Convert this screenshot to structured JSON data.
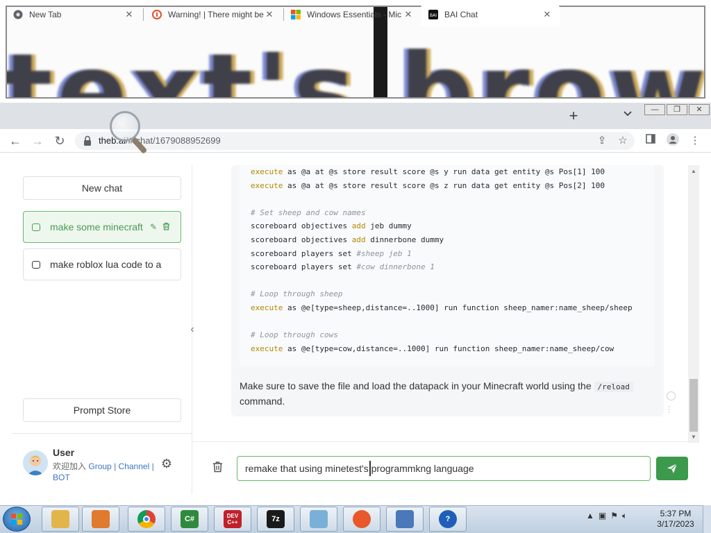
{
  "magnifier": {
    "text": "text's brows"
  },
  "browser": {
    "tabs": [
      {
        "title": "New Tab",
        "icon": "chrome-icon"
      },
      {
        "title": "Warning! | There might be",
        "icon": "warning-site-icon"
      },
      {
        "title": "Windows Essentials - Mic",
        "icon": "microsoft-icon"
      },
      {
        "title": "BAI Chat",
        "icon": "bai-icon",
        "active": true
      }
    ],
    "url_host": "theb.ai",
    "url_path": "/#/chat/1679088952699"
  },
  "sidebar": {
    "new_chat_label": "New chat",
    "chats": [
      {
        "title": "make some minecraft",
        "active": true
      },
      {
        "title": "make roblox lua code to a",
        "active": false
      }
    ],
    "prompt_store_label": "Prompt Store",
    "user": {
      "name": "User",
      "join_text": "欢迎加入",
      "group_link": "Group",
      "sep1": "|",
      "channel_link": "Channel",
      "sep2": "|",
      "bot_link": "BOT"
    }
  },
  "message": {
    "code_lines": [
      [
        {
          "t": "execute",
          "c": "kw"
        },
        {
          "t": " as @a at @s store result score @s y run data get entity @s Pos[1] 100"
        }
      ],
      [
        {
          "t": "execute",
          "c": "kw"
        },
        {
          "t": " as @a at @s store result score @s z run data get entity @s Pos[2] 100"
        }
      ],
      [],
      [
        {
          "t": "# Set sheep and cow names",
          "c": "cm"
        }
      ],
      [
        {
          "t": "scoreboard objectives "
        },
        {
          "t": "add",
          "c": "kw"
        },
        {
          "t": " jeb dummy"
        }
      ],
      [
        {
          "t": "scoreboard objectives "
        },
        {
          "t": "add",
          "c": "kw"
        },
        {
          "t": " dinnerbone dummy"
        }
      ],
      [
        {
          "t": "scoreboard players set "
        },
        {
          "t": "#sheep jeb 1",
          "c": "cm"
        }
      ],
      [
        {
          "t": "scoreboard players set "
        },
        {
          "t": "#cow dinnerbone 1",
          "c": "cm"
        }
      ],
      [],
      [
        {
          "t": "# Loop through sheep",
          "c": "cm"
        }
      ],
      [
        {
          "t": "execute",
          "c": "kw"
        },
        {
          "t": " as @e[type=sheep,distance=..1000] run function sheep_namer:name_sheep/sheep"
        }
      ],
      [],
      [
        {
          "t": "# Loop through cows",
          "c": "cm"
        }
      ],
      [
        {
          "t": "execute",
          "c": "kw"
        },
        {
          "t": " as @e[type=cow,distance=..1000] run function sheep_namer:name_sheep/cow"
        }
      ]
    ],
    "after_text_1": "Make sure to save the file and load the datapack in your Minecraft world using the",
    "inline_code": "/reload",
    "after_text_2": "command."
  },
  "composer": {
    "input_value": "remake that using minetest's programmkng language"
  },
  "taskbar": {
    "apps": [
      {
        "name": "explorer-icon",
        "label": "",
        "color": "#e2b54a"
      },
      {
        "name": "media-player-icon",
        "label": "",
        "color": "#e07a2c"
      },
      {
        "name": "chrome-icon",
        "label": "",
        "color": "#ffffff"
      },
      {
        "name": "csharp-icon",
        "label": "C#",
        "color": "#2f8a3c"
      },
      {
        "name": "devcpp-icon",
        "label": "DEV C++",
        "color": "#c0202a"
      },
      {
        "name": "7zip-icon",
        "label": "7z",
        "color": "#1a1a1a"
      },
      {
        "name": "paint-icon",
        "label": "",
        "color": "#7ab0d8"
      },
      {
        "name": "firefox-icon",
        "label": "",
        "color": "#e8582a"
      },
      {
        "name": "network-app-icon",
        "label": "",
        "color": "#4a78b8"
      },
      {
        "name": "help-icon",
        "label": "?",
        "color": "#1f5fb8"
      }
    ],
    "time": "5:37 PM",
    "date": "3/17/2023"
  },
  "colors": {
    "accent_green": "#3c9a4c",
    "active_chat_bg": "#eef7ee"
  }
}
